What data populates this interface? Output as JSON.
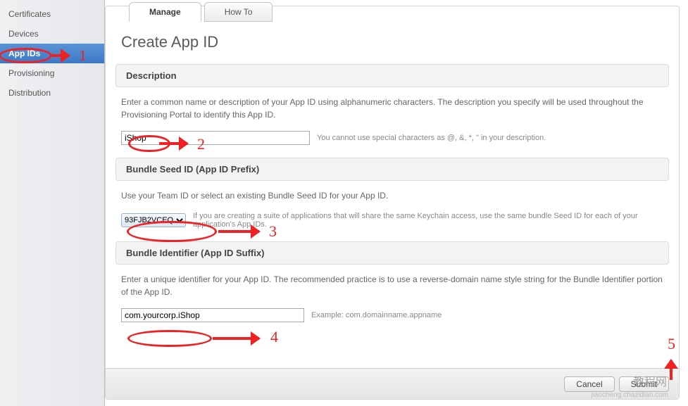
{
  "sidebar": {
    "items": [
      {
        "label": "Certificates"
      },
      {
        "label": "Devices"
      },
      {
        "label": "App IDs"
      },
      {
        "label": "Provisioning"
      },
      {
        "label": "Distribution"
      }
    ]
  },
  "tabs": {
    "manage": "Manage",
    "howto": "How To"
  },
  "page_title": "Create App ID",
  "description_section": {
    "header": "Description",
    "text": "Enter a common name or description of your App ID using alphanumeric characters. The description you specify will be used throughout the Provisioning Portal to identify this App ID.",
    "input_value": "iShop",
    "hint": "You cannot use special characters as @, &, *, \" in your description."
  },
  "prefix_section": {
    "header": "Bundle Seed ID (App ID Prefix)",
    "text": "Use your Team ID or select an existing Bundle Seed ID for your App ID.",
    "select_value": "93FJB2VCEQ",
    "hint": "If you are creating a suite of applications that will share the same Keychain access, use the same bundle Seed ID for each of your application's App IDs."
  },
  "suffix_section": {
    "header": "Bundle Identifier (App ID Suffix)",
    "text": "Enter a unique identifier for your App ID. The recommended practice is to use a reverse-domain name style string for the Bundle Identifier portion of the App ID.",
    "input_value": "com.yourcorp.iShop",
    "hint": "Example: com.domainname.appname"
  },
  "footer": {
    "cancel": "Cancel",
    "submit": "Submit"
  },
  "annotations": {
    "n1": "1",
    "n2": "2",
    "n3": "3",
    "n4": "4",
    "n5": "5"
  },
  "watermark": {
    "main": "教程网",
    "sub": "jiaocheng.chazidian.com"
  }
}
